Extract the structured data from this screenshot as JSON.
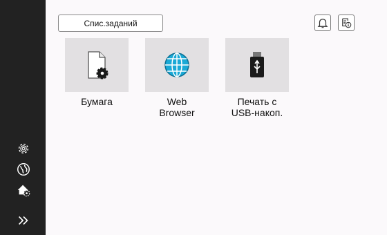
{
  "header": {
    "jobs_button_label": "Спис.заданий",
    "notification_icon": "bell-icon",
    "status_icon": "device-info-icon"
  },
  "apps": [
    {
      "label": "Бумага",
      "icon": "paper-settings-icon"
    },
    {
      "label": "Web\nBrowser",
      "icon": "globe-icon"
    },
    {
      "label": "Печать с\nUSB-накоп.",
      "icon": "usb-drive-icon"
    }
  ],
  "sidebar": {
    "items": [
      {
        "icon": "gear-icon"
      },
      {
        "icon": "globe-icon"
      },
      {
        "icon": "home-settings-icon"
      },
      {
        "icon": "double-chevron-right-icon"
      }
    ]
  },
  "colors": {
    "sidebar_bg": "#222222",
    "screen_bg": "#fbf9fb",
    "tile_bg": "#e2e0e2",
    "globe_accent": "#19a9d6"
  }
}
